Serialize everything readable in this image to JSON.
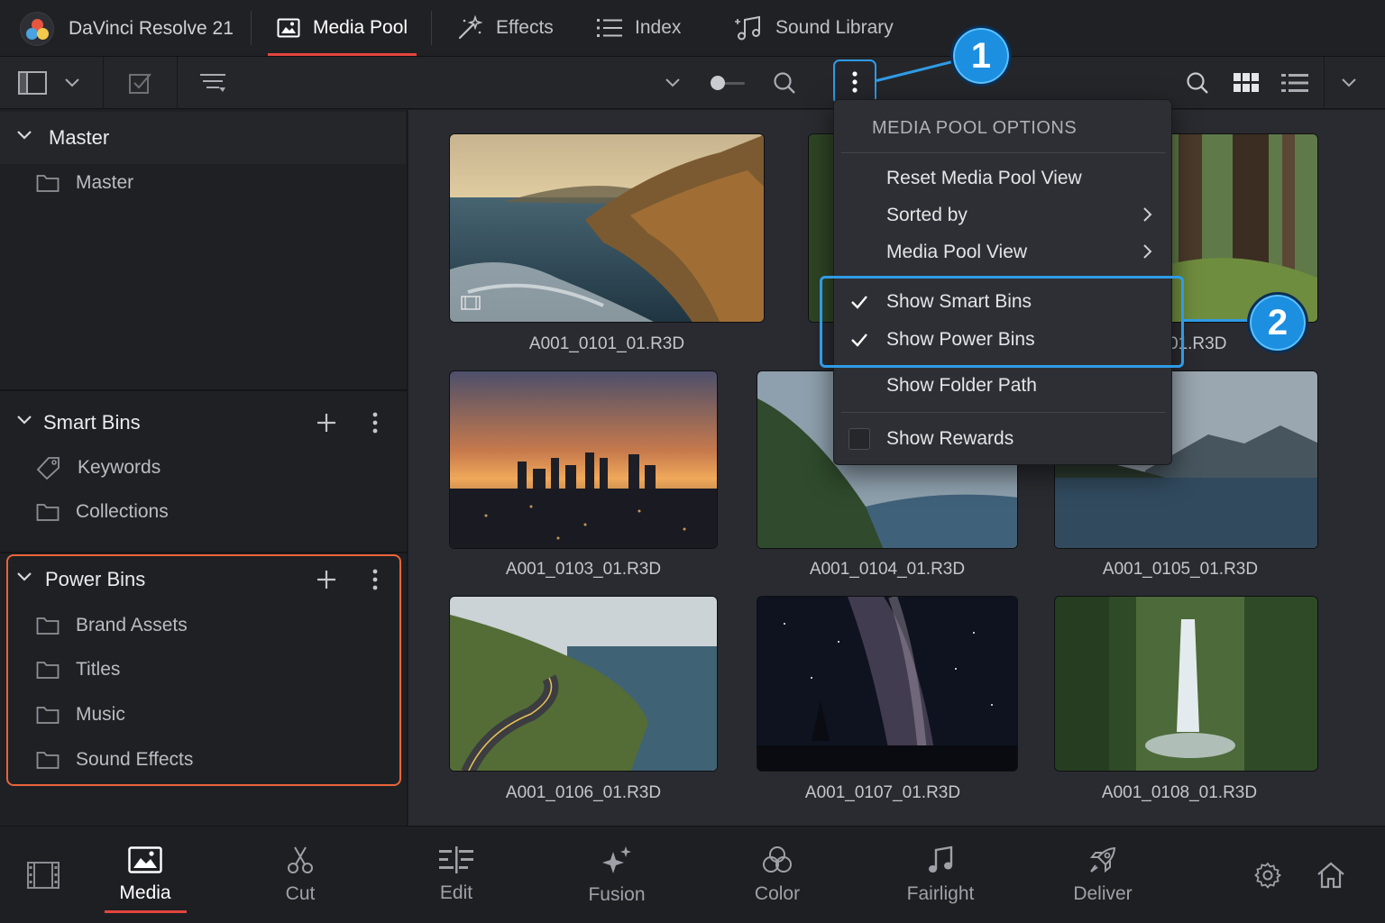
{
  "app": {
    "title": "DaVinci Resolve 21"
  },
  "tabs": [
    {
      "label": "Media Pool",
      "icon": "media-pool-icon",
      "active": true
    },
    {
      "label": "Effects",
      "icon": "magic-wand-icon"
    },
    {
      "label": "Index",
      "icon": "list-icon"
    },
    {
      "label": "Sound Library",
      "icon": "music-note-icon"
    }
  ],
  "sidebar": {
    "master": {
      "label": "Master",
      "bins": [
        "Master"
      ]
    },
    "smart_bins": {
      "label": "Smart Bins",
      "bins": [
        "Keywords",
        "Collections"
      ]
    },
    "power_bins": {
      "label": "Power Bins",
      "bins": [
        "Brand Assets",
        "Titles",
        "Music",
        "Sound Effects"
      ]
    }
  },
  "clips": [
    "A001_0101_01.R3D",
    "01.R3D",
    "A001_0103_01.R3D",
    "A001_0104_01.R3D",
    "A001_0105_01.R3D",
    "A001_0106_01.R3D",
    "A001_0107_01.R3D",
    "A001_0108_01.R3D"
  ],
  "menu": {
    "title": "MEDIA POOL OPTIONS",
    "items": [
      {
        "label": "Reset Media Pool View"
      },
      {
        "label": "Sorted by",
        "submenu": true
      },
      {
        "label": "Media Pool View",
        "submenu": true
      },
      {
        "label": "Show Smart Bins",
        "checked": true
      },
      {
        "label": "Show Power Bins",
        "checked": true
      },
      {
        "label": "Show Folder Path"
      },
      {
        "label": "Show Rewards",
        "checked": false
      }
    ]
  },
  "callouts": {
    "first": "1",
    "second": "2"
  },
  "pages": [
    {
      "label": "Media",
      "active": true
    },
    {
      "label": "Cut"
    },
    {
      "label": "Edit"
    },
    {
      "label": "Fusion"
    },
    {
      "label": "Color"
    },
    {
      "label": "Fairlight"
    },
    {
      "label": "Deliver"
    }
  ],
  "colors": {
    "accent_blue": "#2f9be6",
    "accent_red": "#e2453d",
    "power_bins_outline": "#e9643a"
  }
}
